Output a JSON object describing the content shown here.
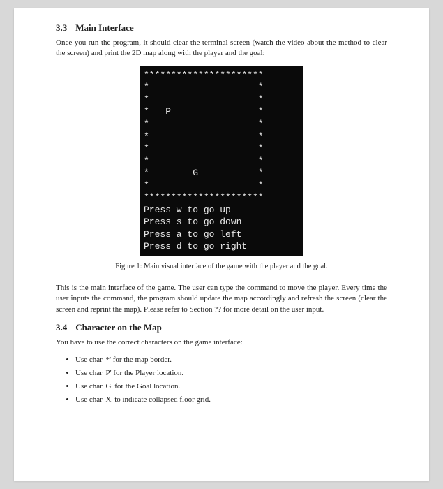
{
  "section1": {
    "number": "3.3",
    "title": "Main Interface",
    "intro": "Once you run the program, it should clear the terminal screen (watch the video about the method to clear the screen) and print the 2D map along with the player and the goal:"
  },
  "terminal": {
    "content": "**********************\n*                    *\n*                    *\n*   P                *\n*                    *\n*                    *\n*                    *\n*                    *\n*        G           *\n*                    *\n**********************\nPress w to go up\nPress s to go down\nPress a to go left\nPress d to go right"
  },
  "figure": {
    "caption": "Figure 1: Main visual interface of the game with the player and the goal."
  },
  "section1_after": "This is the main interface of the game. The user can type the command to move the player. Every time the user inputs the command, the program should update the map accordingly and refresh the screen (clear the screen and reprint the map). Please refer to Section ?? for more detail on the user input.",
  "section2": {
    "number": "3.4",
    "title": "Character on the Map",
    "intro": "You have to use the correct characters on the game interface:",
    "bullets": [
      "Use char '*' for the map border.",
      "Use char 'P' for the Player location.",
      "Use char 'G' for the Goal location.",
      "Use char 'X' to indicate collapsed floor grid."
    ]
  }
}
